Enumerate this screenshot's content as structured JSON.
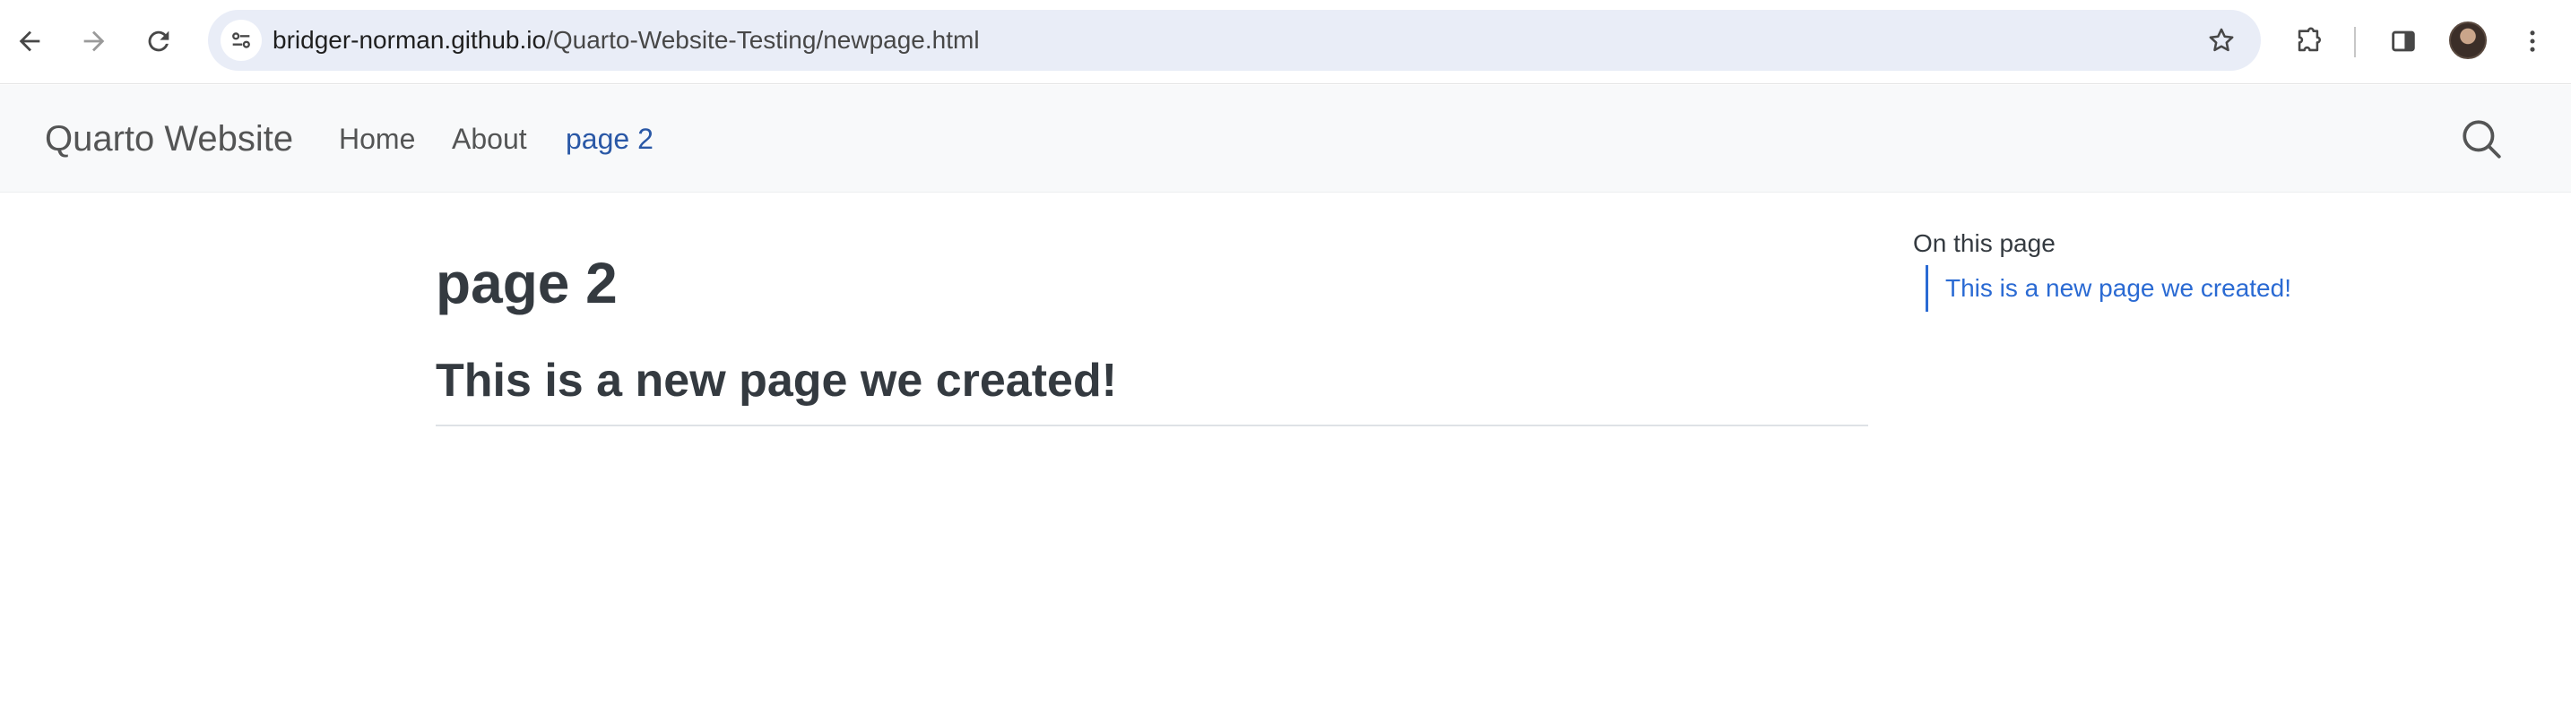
{
  "browser": {
    "url_host": "bridger-norman.github.io",
    "url_path": "/Quarto-Website-Testing/newpage.html",
    "icons": [
      "back-arrow-icon",
      "forward-arrow-icon",
      "reload-icon",
      "site-settings-icon",
      "bookmark-star-icon",
      "extensions-icon",
      "side-panel-icon",
      "profile-avatar",
      "more-menu-icon"
    ]
  },
  "navbar": {
    "brand": "Quarto Website",
    "links": [
      {
        "label": "Home"
      },
      {
        "label": "About"
      },
      {
        "label": "page 2",
        "active": true
      }
    ],
    "search_icon": "search-icon"
  },
  "content": {
    "title": "page 2",
    "section_heading": "This is a new page we created!"
  },
  "toc": {
    "title": "On this page",
    "items": [
      {
        "label": "This is a new page we created!"
      }
    ]
  },
  "colors": {
    "link": "#2a6ad3",
    "navbar_bg": "#f8f9fa",
    "heading": "#343a40",
    "omnibox_bg": "#e9edf7"
  }
}
